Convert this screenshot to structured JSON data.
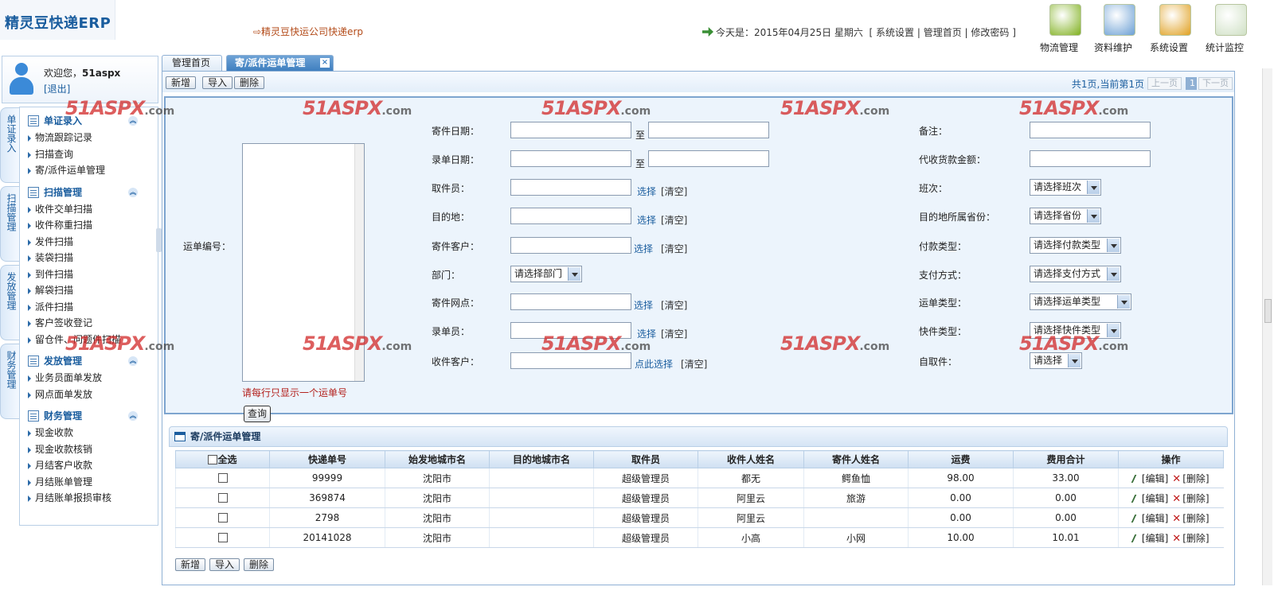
{
  "app": {
    "logo": "精灵豆快递ERP",
    "slogan": "⇨精灵豆快运公司快递erp"
  },
  "header": {
    "date_text": "今天是：2015年04月25日 星期六",
    "links": [
      "系统设置",
      "管理首页",
      "修改密码"
    ],
    "icons": [
      {
        "label": "物流管理",
        "color": "#7fb01e"
      },
      {
        "label": "资料维护",
        "color": "#6a9fd4"
      },
      {
        "label": "系统设置",
        "color": "#e0a020"
      },
      {
        "label": "统计监控",
        "color": "#cfe0c4"
      }
    ]
  },
  "user": {
    "welcome": "欢迎您，",
    "name": "51aspx",
    "logout": "[退出]"
  },
  "vtabs": [
    "单证录入",
    "扫描管理",
    "发放管理",
    "财务管理"
  ],
  "menu": {
    "groups": [
      {
        "title": "单证录入",
        "items": [
          "物流跟踪记录",
          "扫描查询",
          "寄/派件运单管理"
        ]
      },
      {
        "title": "扫描管理",
        "items": [
          "收件交单扫描",
          "收件称重扫描",
          "发件扫描",
          "装袋扫描",
          "到件扫描",
          "解袋扫描",
          "派件扫描",
          "客户签收登记",
          "留仓件、问题件扫描"
        ]
      },
      {
        "title": "发放管理",
        "items": [
          "业务员面单发放",
          "网点面单发放"
        ]
      },
      {
        "title": "财务管理",
        "items": [
          "现金收款",
          "现金收款核销",
          "月结客户收款",
          "月结账单管理",
          "月结账单报损审核"
        ]
      }
    ]
  },
  "tabs": {
    "home": "管理首页",
    "active": "寄/派件运单管理"
  },
  "toolbar": {
    "add": "新增",
    "import": "导入",
    "delete": "删除"
  },
  "pager": {
    "info": "共1页,当前第1页",
    "prev": "上一页",
    "page": "1",
    "next": "下一页"
  },
  "form": {
    "waybill_label": "运单编号：",
    "hint": "请每行只显示一个运单号",
    "query": "查询",
    "to": "至",
    "pick": "选择",
    "pick_here": "点此选择",
    "clear": "[清空]",
    "send_date": "寄件日期：",
    "entry_date": "录单日期：",
    "pickup_staff": "取件员：",
    "destination": "目的地：",
    "sender_customer": "寄件客户：",
    "department": "部门：",
    "department_sel": "请选择部门",
    "send_outlet": "寄件网点：",
    "entry_staff": "录单员：",
    "receiver_customer": "收件客户：",
    "remark": "备注：",
    "cod_amount": "代收货款金额：",
    "shift": "班次：",
    "shift_sel": "请选择班次",
    "dest_province": "目的地所属省份：",
    "province_sel": "请选择省份",
    "pay_type": "付款类型：",
    "pay_type_sel": "请选择付款类型",
    "pay_method": "支付方式：",
    "pay_method_sel": "请选择支付方式",
    "waybill_type": "运单类型：",
    "waybill_type_sel": "请选择运单类型",
    "parcel_type": "快件类型：",
    "parcel_type_sel": "请选择快件类型",
    "self_pickup": "自取件：",
    "self_pickup_sel": "请选择"
  },
  "grid": {
    "title": "寄/派件运单管理",
    "select_all": "全选",
    "headers": [
      "快递单号",
      "始发地城市名",
      "目的地城市名",
      "取件员",
      "收件人姓名",
      "寄件人姓名",
      "运费",
      "费用合计",
      "操作"
    ],
    "edit": "[编辑]",
    "del": "[删除]",
    "rows": [
      [
        "99999",
        "沈阳市",
        "",
        "超级管理员",
        "都无",
        "鳄鱼恤",
        "98.00",
        "33.00"
      ],
      [
        "369874",
        "沈阳市",
        "",
        "超级管理员",
        "阿里云",
        "旅游",
        "0.00",
        "0.00"
      ],
      [
        "2798",
        "沈阳市",
        "",
        "超级管理员",
        "阿里云",
        "",
        "0.00",
        "0.00"
      ],
      [
        "20141028",
        "沈阳市",
        "",
        "超级管理员",
        "小高",
        "小网",
        "10.00",
        "10.01"
      ]
    ]
  },
  "watermark": {
    "brand": "51ASPX",
    "suffix": ".com"
  }
}
